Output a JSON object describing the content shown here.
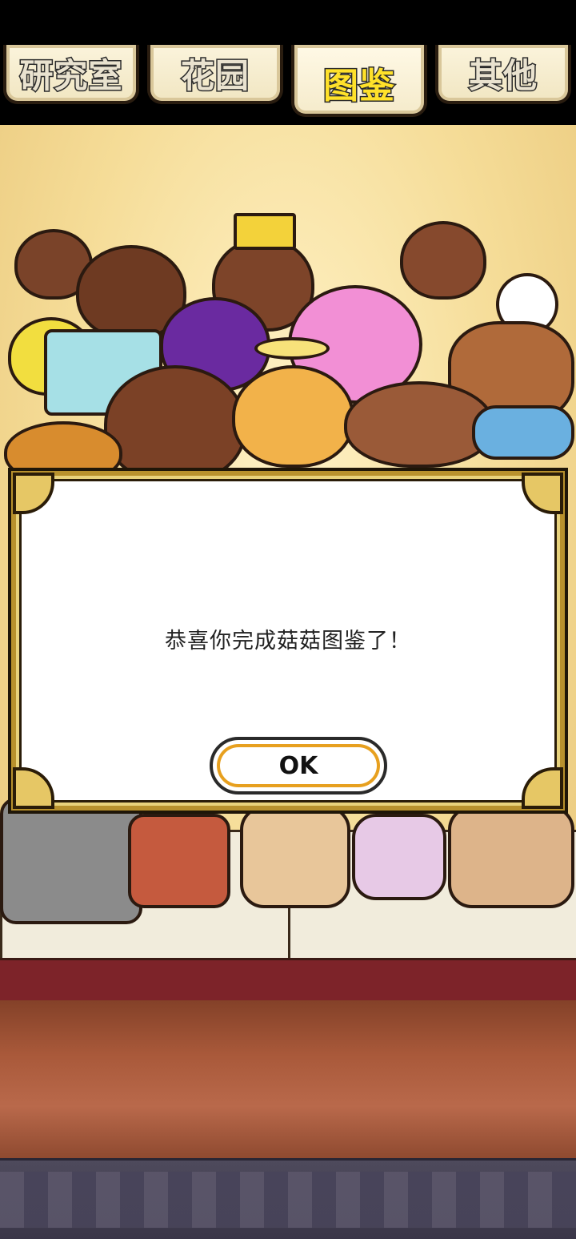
{
  "tabs": [
    {
      "label": "研究室",
      "active": false
    },
    {
      "label": "花园",
      "active": false
    },
    {
      "label": "图鉴",
      "active": true
    },
    {
      "label": "其他",
      "active": false
    }
  ],
  "dialog": {
    "message": "恭喜你完成菇菇图鉴了！",
    "ok_label": "OK"
  },
  "colors": {
    "active_tab_text": "#ffe12a",
    "tab_text": "#e9e2cf",
    "dialog_frame": "#b8912d",
    "ok_ring": "#e7a01f"
  }
}
